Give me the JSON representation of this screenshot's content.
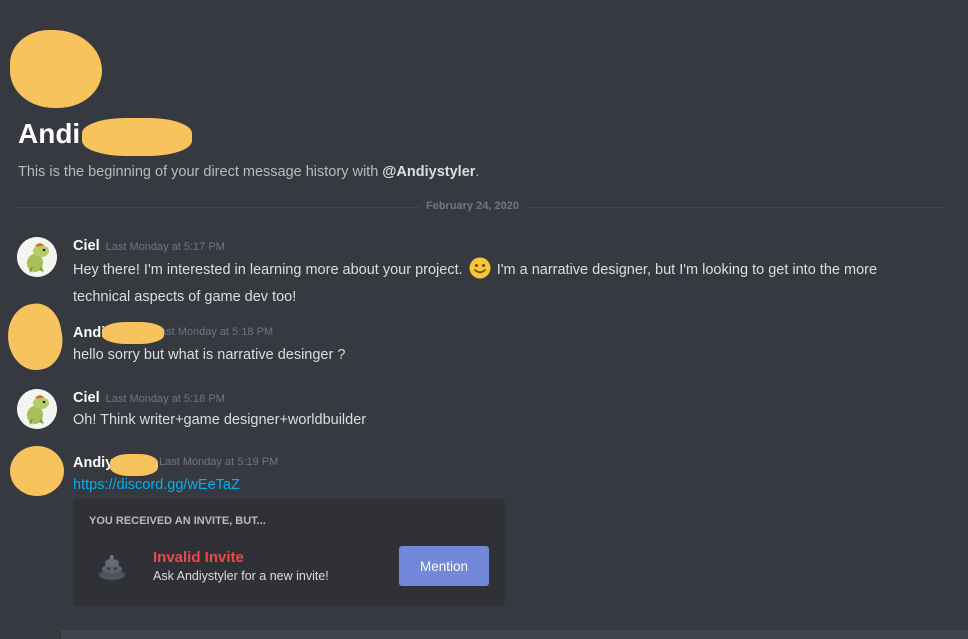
{
  "dm_header": {
    "name": "Andi",
    "intro_prefix": "This is the beginning of your direct message history with ",
    "intro_handle": "@Andiystyler",
    "intro_suffix": "."
  },
  "divider_date": "February 24, 2020",
  "messages": [
    {
      "author": "Ciel",
      "timestamp": "Last Monday at 5:17 PM",
      "text_before_emoji": "Hey there! I'm interested in learning more about your project.",
      "emoji": "slightly-smiling-face",
      "text_after_emoji": "I'm a narrative designer, but I'm looking to get into the more technical aspects of game dev too!"
    },
    {
      "author": "Andi",
      "timestamp": "ast Monday at 5:18 PM",
      "text": "hello sorry but what is narrative desinger ?"
    },
    {
      "author": "Ciel",
      "timestamp": "Last Monday at 5:18 PM",
      "text": "Oh! Think writer+game designer+worldbuilder"
    },
    {
      "author": "Andiy",
      "timestamp": "Last Monday at 5:19 PM",
      "link": "https://discord.gg/wEeTaZ"
    }
  ],
  "invite": {
    "header": "YOU RECEIVED AN INVITE, BUT...",
    "title": "Invalid Invite",
    "subtitle": "Ask Andiystyler for a new invite!",
    "button_label": "Mention",
    "icon": "poop-icon"
  },
  "colors": {
    "background": "#36393f",
    "card": "#2f3136",
    "blurb": "#f6c35c",
    "link": "#00b0f4",
    "error": "#f04747",
    "button": "#7289da"
  }
}
